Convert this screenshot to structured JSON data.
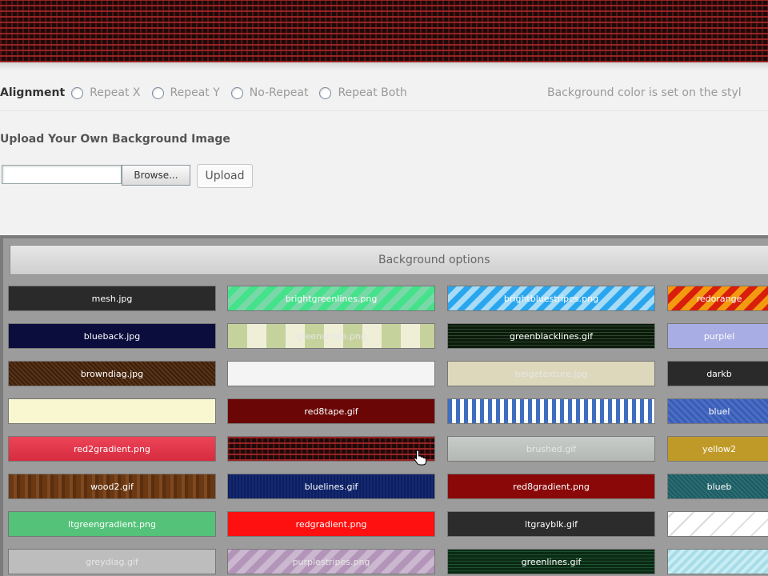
{
  "alignment": {
    "label": "Alignment",
    "options": [
      "Repeat X",
      "Repeat Y",
      "No-Repeat",
      "Repeat Both"
    ],
    "note": "Background color is set on the styl"
  },
  "upload": {
    "title": "Upload Your Own Background Image",
    "browse_label": "Browse...",
    "upload_label": "Upload"
  },
  "panel": {
    "title": "Background options"
  },
  "swatches": {
    "c0": [
      "mesh.jpg",
      "blueback.jpg",
      "browndiag.jpg",
      "",
      "red2gradient.png",
      "wood2.gif",
      "ltgreengradient.png",
      "greydiag.gif"
    ],
    "c1": [
      "brightgreenlines.png",
      "greenstripe.png",
      "",
      "red8tape.gif",
      "",
      "bluelines.gif",
      "redgradient.png",
      "purplestripes.png"
    ],
    "c2": [
      "brightbluestripes.png",
      "greenblacklines.gif",
      "beigetexture.jpg",
      "",
      "brushed.gif",
      "red8gradient.png",
      "ltgrayblk.gif",
      "greenlines.gif"
    ],
    "c3": [
      "redorange",
      "purplel",
      "darkb",
      "bluel",
      "yellow2",
      "blueb",
      "",
      ""
    ]
  },
  "colors": {
    "banner": "#1c0a0a",
    "panel": "#9c9c9c"
  }
}
